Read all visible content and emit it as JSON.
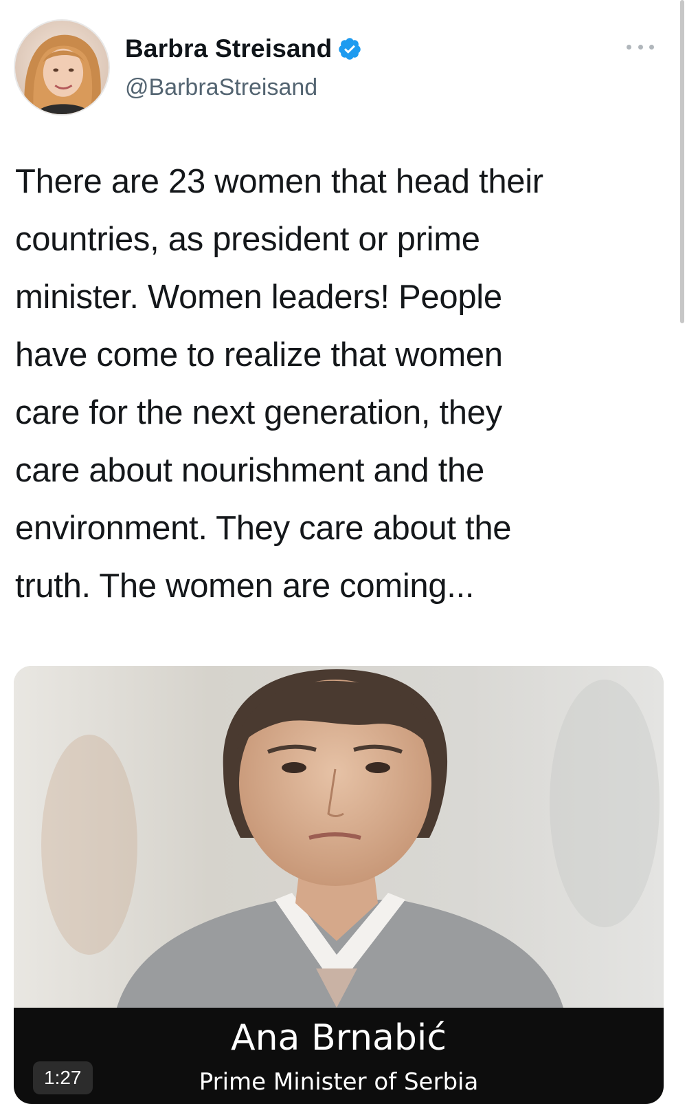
{
  "author": {
    "display_name": "Barbra Streisand",
    "handle": "@BarbraStreisand",
    "verified": true,
    "avatar_icon": "profile-photo-icon",
    "verified_color": "#1d9bf0"
  },
  "tweet": {
    "text": "There are 23 women that head their\ncountries, as president or prime\nminister. Women leaders! People\nhave come to realize that women\ncare for the next generation, they\ncare about nourishment and the\nenvironment. They care about the\ntruth. The women are coming..."
  },
  "media": {
    "caption_name": "Ana Brnabić",
    "caption_title": "Prime Minister of Serbia",
    "duration": "1:27"
  }
}
